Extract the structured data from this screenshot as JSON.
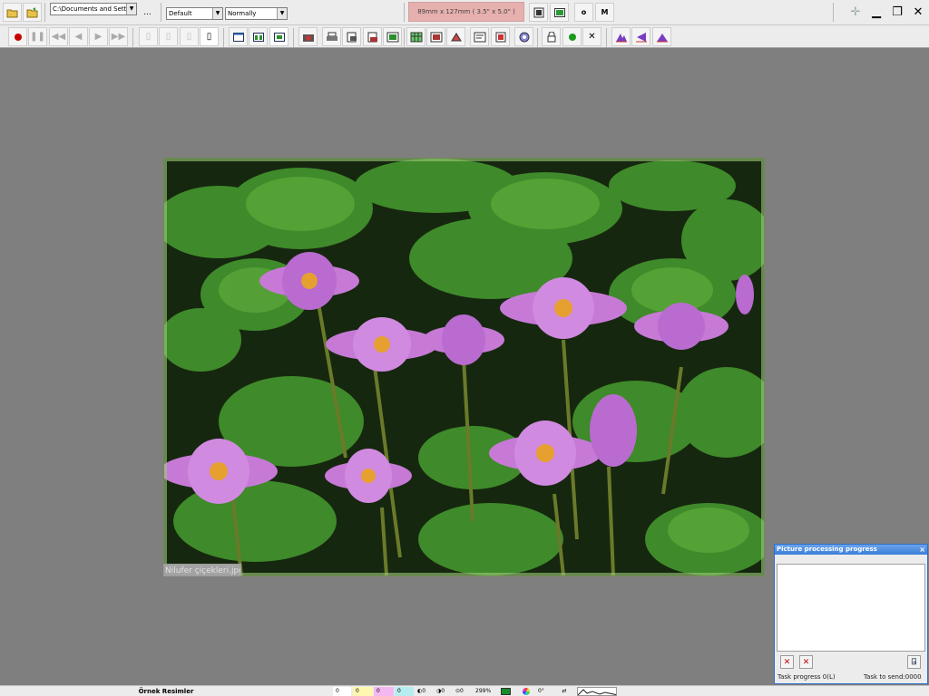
{
  "toolbar": {
    "path_combo": "C:\\Documents and Settings",
    "browse_label": "...",
    "profile_combo": "Default",
    "mode_combo": "Normally",
    "print_size": "89mm x 127mm ( 3.5\" x 5.0\" )",
    "o_label": "o",
    "m_label": "M",
    "window_controls": {
      "move": "✛",
      "minimize": "▁",
      "restore": "❐",
      "close": "✕"
    }
  },
  "image": {
    "filename": "Nilufer çiçekleri.jpg"
  },
  "panel": {
    "title": "Picture processing progress",
    "close": "×",
    "task_progress": "Task progress 0(L)",
    "task_to_send": "Task to send:0000"
  },
  "status": {
    "folder": "Örnek Resimler",
    "val_a": "0",
    "val_b": "0",
    "val_c": "0",
    "val_d": "0",
    "brightness": "0",
    "contrast": "0",
    "saturation": "0",
    "zoom": "299%",
    "rotation": "0°"
  },
  "colors": {
    "panel_border": "#2f6fc6",
    "size_box": "#e6b0ae",
    "status_a": "#ffffff",
    "status_b": "#fff7b0",
    "status_c": "#f4b8f0",
    "status_d": "#b6eef0"
  },
  "icons": [
    "open-folder-icon",
    "save-folder-icon",
    "record-icon",
    "pause-icon",
    "rewind-icon",
    "prev-icon",
    "play-icon",
    "fast-forward-icon",
    "page-icon",
    "layout-icon",
    "printer-icon",
    "lock-icon",
    "green-dot-icon",
    "close-icon",
    "histogram-icon",
    "move-icon",
    "minimize-icon",
    "restore-icon",
    "cancel-task-icon",
    "cancel-all-icon",
    "exit-icon"
  ]
}
